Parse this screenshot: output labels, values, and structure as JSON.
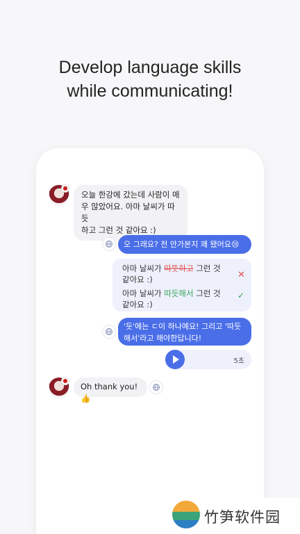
{
  "headline": {
    "line1": "Develop language skills",
    "line2": "while communicating!"
  },
  "chat": {
    "msg1": {
      "line1": "오늘 한강에 갔는데 사람이 매",
      "line2": "우 많았어요. 아마 날씨가 따듯",
      "line3": "하고 그런 것 같아요 :)"
    },
    "msg2": "오 그래요? 전 안가본지 꽤 됐어요😢",
    "correction": {
      "row1_before": "아마 날씨가 ",
      "row1_wrong": "따뜻하고",
      "row1_after": " 그런 것",
      "row1_line2": "같아요 :)",
      "row2_before": "아마 날씨가 ",
      "row2_fixed": "따듯해서",
      "row2_after": " 그런 것",
      "row2_line2": "같아요 :)"
    },
    "msg3": {
      "line1": "'듯'에는 ㄷ이 하나예요! 그리고 '따듯",
      "line2": "해서'라고 해야한답니다!"
    },
    "audio": {
      "duration": "5초"
    },
    "msg4": "Oh thank you!👍"
  },
  "icons": {
    "globe": "globe-icon",
    "play": "play-icon",
    "wrong": "x-mark-icon",
    "correct": "check-mark-icon",
    "flag": "korea-flag-icon"
  },
  "colors": {
    "accent": "#4a6ee8",
    "wrong": "#e05252",
    "correct": "#35a35a"
  },
  "watermark": {
    "text": "竹笋软件园"
  }
}
